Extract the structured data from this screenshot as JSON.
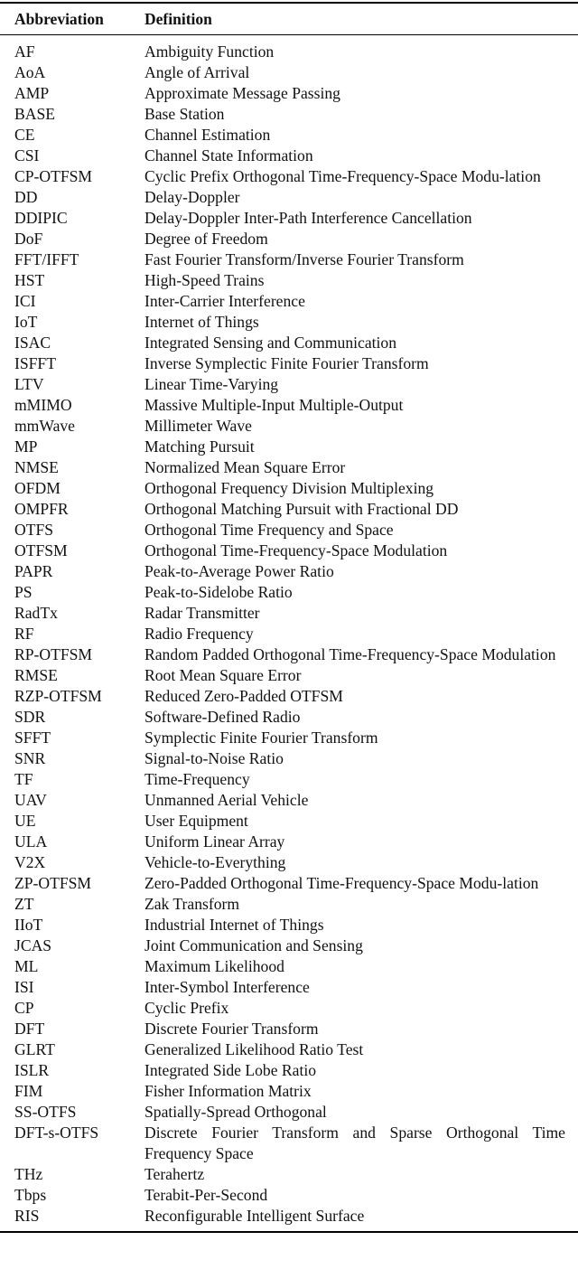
{
  "table": {
    "headers": {
      "abbreviation": "Abbreviation",
      "definition": "Definition"
    },
    "rows": [
      {
        "abbr": "AF",
        "def": "Ambiguity Function"
      },
      {
        "abbr": "AoA",
        "def": "Angle of Arrival"
      },
      {
        "abbr": "AMP",
        "def": "Approximate Message Passing"
      },
      {
        "abbr": "BASE",
        "def": "Base Station"
      },
      {
        "abbr": "CE",
        "def": "Channel Estimation"
      },
      {
        "abbr": "CSI",
        "def": "Channel State Information"
      },
      {
        "abbr": "CP-OTFSM",
        "def": "Cyclic Prefix Orthogonal Time-Frequency-Space Modu-lation"
      },
      {
        "abbr": "DD",
        "def": "Delay-Doppler"
      },
      {
        "abbr": "DDIPIC",
        "def": "Delay-Doppler Inter-Path Interference Cancellation"
      },
      {
        "abbr": "DoF",
        "def": "Degree of Freedom"
      },
      {
        "abbr": "FFT/IFFT",
        "def": "Fast Fourier Transform/Inverse Fourier Transform"
      },
      {
        "abbr": "HST",
        "def": "High-Speed Trains"
      },
      {
        "abbr": "ICI",
        "def": "Inter-Carrier Interference"
      },
      {
        "abbr": "IoT",
        "def": "Internet of Things"
      },
      {
        "abbr": "ISAC",
        "def": "Integrated Sensing and Communication"
      },
      {
        "abbr": "ISFFT",
        "def": "Inverse Symplectic Finite Fourier Transform"
      },
      {
        "abbr": "LTV",
        "def": "Linear Time-Varying"
      },
      {
        "abbr": "mMIMO",
        "def": "Massive Multiple-Input Multiple-Output"
      },
      {
        "abbr": "mmWave",
        "def": "Millimeter Wave"
      },
      {
        "abbr": "MP",
        "def": "Matching Pursuit"
      },
      {
        "abbr": "NMSE",
        "def": "Normalized Mean Square Error"
      },
      {
        "abbr": "OFDM",
        "def": "Orthogonal Frequency Division Multiplexing"
      },
      {
        "abbr": "OMPFR",
        "def": "Orthogonal Matching Pursuit with Fractional DD"
      },
      {
        "abbr": "OTFS",
        "def": "Orthogonal Time Frequency and Space"
      },
      {
        "abbr": "OTFSM",
        "def": "Orthogonal Time-Frequency-Space Modulation"
      },
      {
        "abbr": "PAPR",
        "def": "Peak-to-Average Power Ratio"
      },
      {
        "abbr": "PS",
        "def": "Peak-to-Sidelobe Ratio"
      },
      {
        "abbr": "RadTx",
        "def": "Radar Transmitter"
      },
      {
        "abbr": "RF",
        "def": "Radio Frequency"
      },
      {
        "abbr": "RP-OTFSM",
        "def": "Random Padded Orthogonal Time-Frequency-Space Modulation"
      },
      {
        "abbr": "RMSE",
        "def": "Root Mean Square Error"
      },
      {
        "abbr": "RZP-OTFSM",
        "def": "Reduced Zero-Padded OTFSM"
      },
      {
        "abbr": "SDR",
        "def": "Software-Defined Radio"
      },
      {
        "abbr": "SFFT",
        "def": "Symplectic Finite Fourier Transform"
      },
      {
        "abbr": "SNR",
        "def": "Signal-to-Noise Ratio"
      },
      {
        "abbr": "TF",
        "def": "Time-Frequency"
      },
      {
        "abbr": "UAV",
        "def": "Unmanned Aerial Vehicle"
      },
      {
        "abbr": "UE",
        "def": "User Equipment"
      },
      {
        "abbr": "ULA",
        "def": "Uniform Linear Array"
      },
      {
        "abbr": "V2X",
        "def": "Vehicle-to-Everything"
      },
      {
        "abbr": "ZP-OTFSM",
        "def": "Zero-Padded Orthogonal Time-Frequency-Space Modu-lation"
      },
      {
        "abbr": "ZT",
        "def": "Zak Transform"
      },
      {
        "abbr": "IIoT",
        "def": "Industrial Internet of Things"
      },
      {
        "abbr": "JCAS",
        "def": "Joint Communication and Sensing"
      },
      {
        "abbr": "ML",
        "def": "Maximum Likelihood"
      },
      {
        "abbr": "ISI",
        "def": "Inter-Symbol Interference"
      },
      {
        "abbr": "CP",
        "def": "Cyclic Prefix"
      },
      {
        "abbr": "DFT",
        "def": "Discrete Fourier Transform"
      },
      {
        "abbr": "GLRT",
        "def": "Generalized Likelihood Ratio Test"
      },
      {
        "abbr": "ISLR",
        "def": "Integrated Side Lobe Ratio"
      },
      {
        "abbr": "FIM",
        "def": "Fisher Information Matrix"
      },
      {
        "abbr": "SS-OTFS",
        "def": "Spatially-Spread Orthogonal"
      },
      {
        "abbr": "DFT-s-OTFS",
        "def": "Discrete Fourier Transform and Sparse Orthogonal Time Frequency Space"
      },
      {
        "abbr": "THz",
        "def": "Terahertz"
      },
      {
        "abbr": "Tbps",
        "def": "Terabit-Per-Second"
      },
      {
        "abbr": "RIS",
        "def": "Reconfigurable Intelligent Surface"
      }
    ]
  }
}
